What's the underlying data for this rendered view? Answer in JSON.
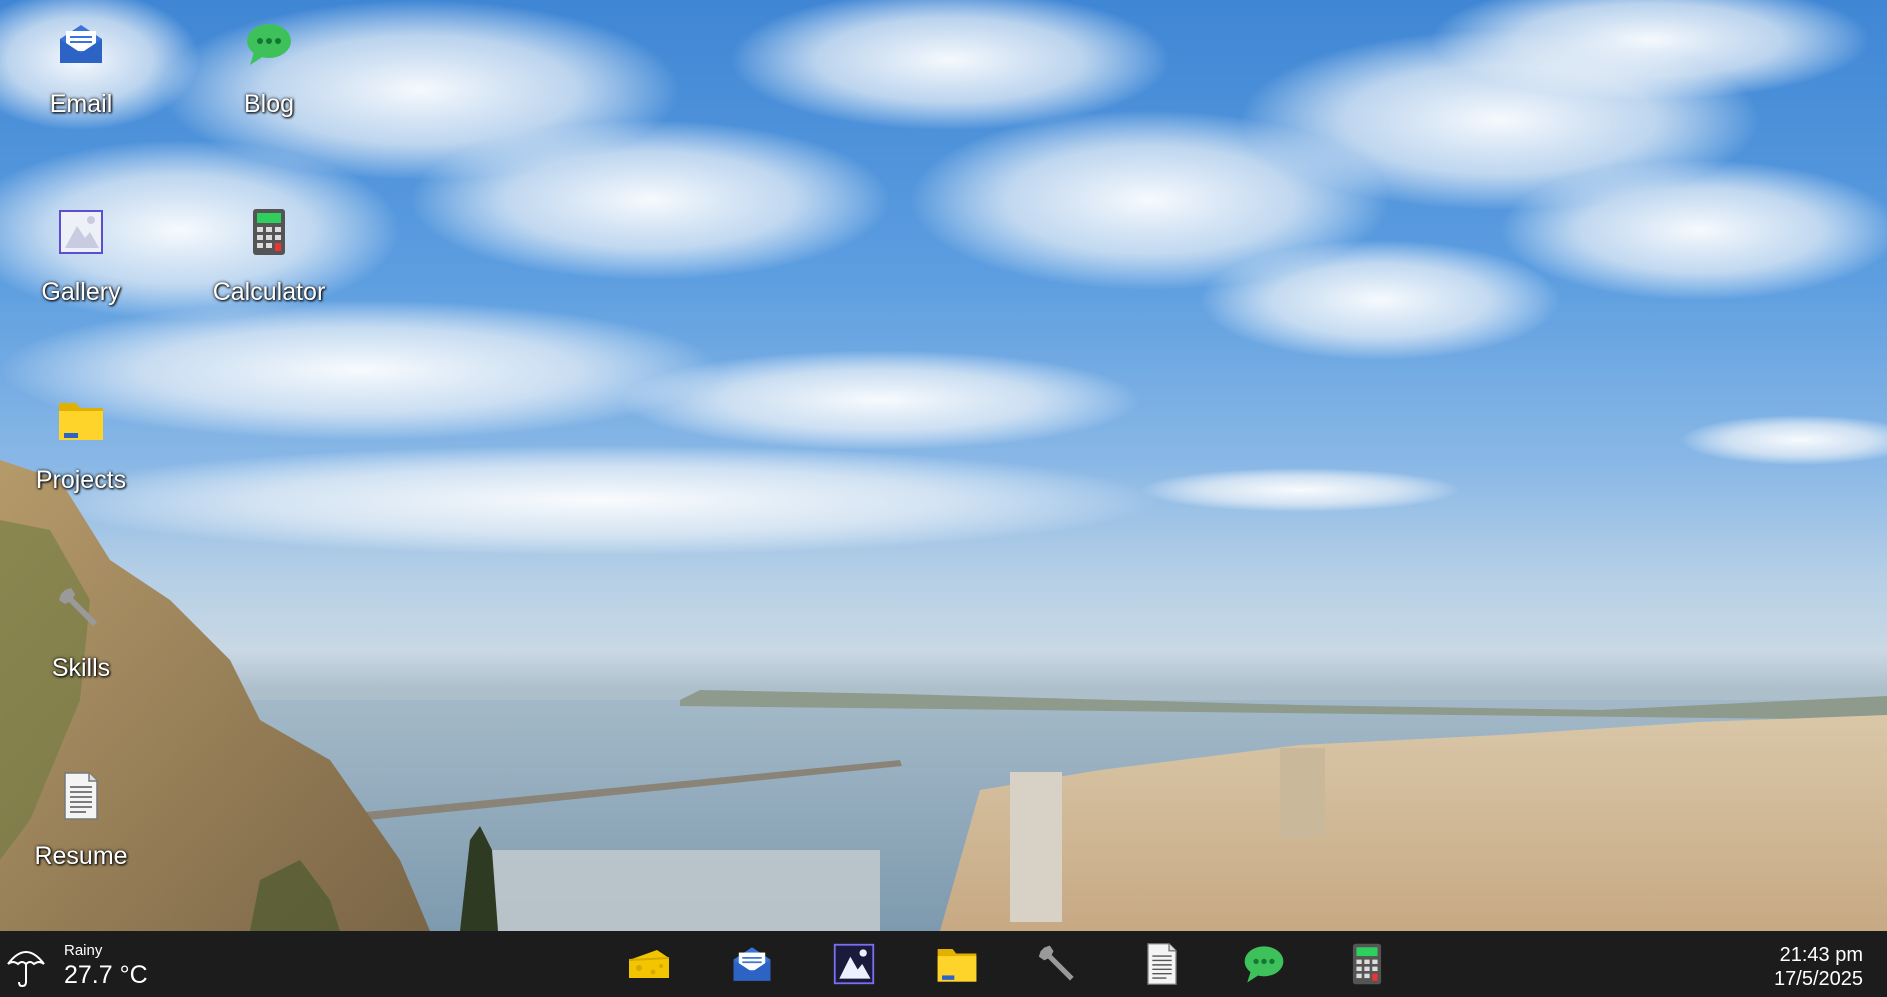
{
  "desktop": {
    "icons": [
      {
        "label": "Email",
        "icon": "envelope-icon"
      },
      {
        "label": "Blog",
        "icon": "chat-bubble-icon"
      },
      {
        "label": "Gallery",
        "icon": "picture-icon"
      },
      {
        "label": "Calculator",
        "icon": "calculator-icon"
      },
      {
        "label": "Projects",
        "icon": "folder-icon"
      },
      {
        "label": "Skills",
        "icon": "wrench-icon"
      },
      {
        "label": "Resume",
        "icon": "document-icon"
      }
    ]
  },
  "taskbar": {
    "weather": {
      "condition": "Rainy",
      "temperature": "27.7 °C",
      "icon": "umbrella-icon"
    },
    "apps": [
      {
        "name": "cheese-icon"
      },
      {
        "name": "envelope-icon"
      },
      {
        "name": "picture-icon"
      },
      {
        "name": "folder-icon"
      },
      {
        "name": "wrench-icon"
      },
      {
        "name": "document-icon"
      },
      {
        "name": "chat-bubble-icon"
      },
      {
        "name": "calculator-icon"
      }
    ],
    "clock": {
      "time": "21:43 pm",
      "date": "17/5/2025"
    }
  },
  "colors": {
    "taskbar": "#1c1c1c",
    "sky": "#3f86d4",
    "label_text": "#ffffff"
  }
}
